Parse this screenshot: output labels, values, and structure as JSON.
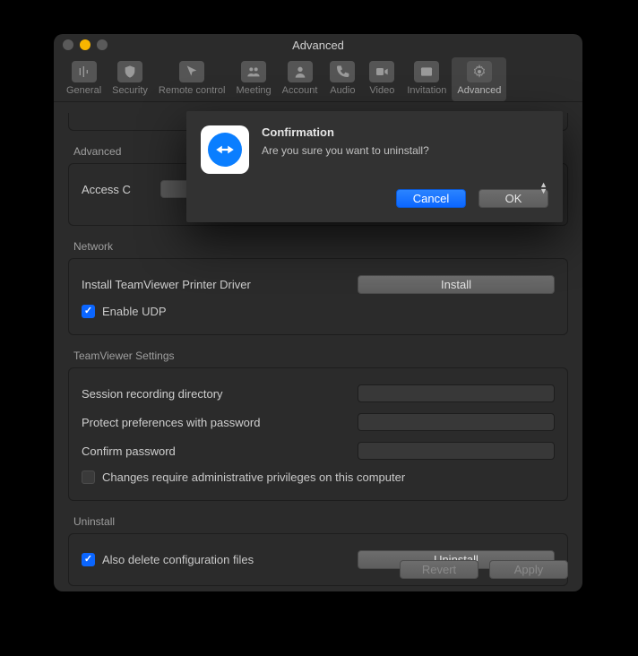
{
  "window": {
    "title": "Advanced"
  },
  "tabs": [
    {
      "label": "General"
    },
    {
      "label": "Security"
    },
    {
      "label": "Remote control"
    },
    {
      "label": "Meeting"
    },
    {
      "label": "Account"
    },
    {
      "label": "Audio"
    },
    {
      "label": "Video"
    },
    {
      "label": "Invitation"
    },
    {
      "label": "Advanced"
    }
  ],
  "groups": {
    "advanced": {
      "title": "Advanced",
      "access_label": "Access C"
    },
    "network": {
      "title": "Network",
      "install_driver_label": "Install TeamViewer Printer Driver",
      "install_button": "Install",
      "enable_udp_label": "Enable UDP",
      "enable_udp_checked": true
    },
    "tv_settings": {
      "title": "TeamViewer Settings",
      "session_dir_label": "Session recording directory",
      "protect_pw_label": "Protect preferences with password",
      "confirm_pw_label": "Confirm password",
      "admin_req_label": "Changes require administrative privileges on this computer",
      "admin_req_checked": false
    },
    "uninstall": {
      "title": "Uninstall",
      "delete_config_label": "Also delete configuration files",
      "delete_config_checked": true,
      "uninstall_button": "Uninstall"
    }
  },
  "footer": {
    "revert": "Revert",
    "apply": "Apply"
  },
  "dialog": {
    "title": "Confirmation",
    "message": "Are you sure you want to uninstall?",
    "cancel": "Cancel",
    "ok": "OK"
  }
}
